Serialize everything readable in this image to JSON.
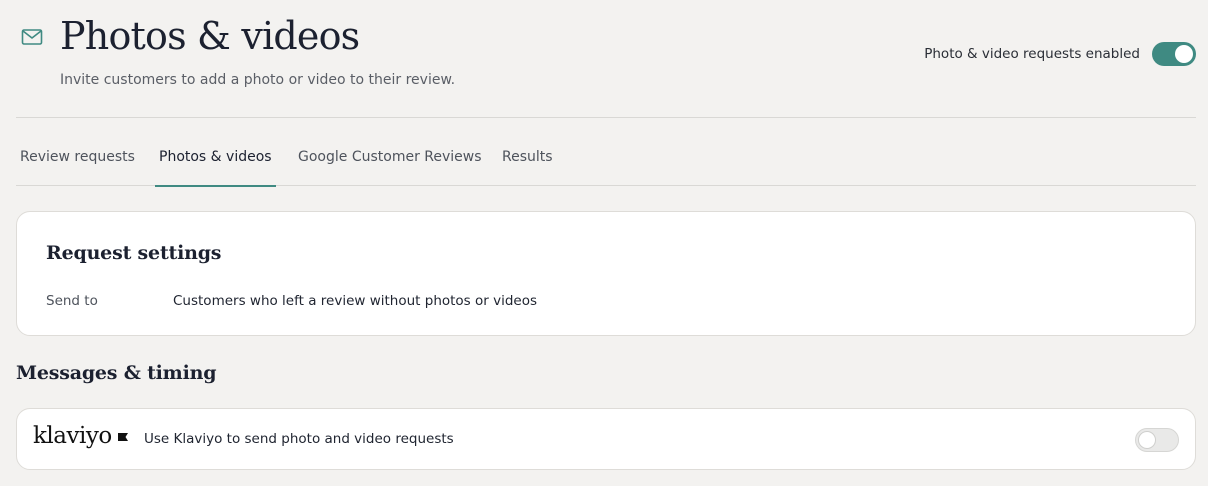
{
  "header": {
    "icon": "mail-icon",
    "title": "Photos & videos",
    "subtitle": "Invite customers to add a photo or video to their review.",
    "toggle_label": "Photo & video requests enabled",
    "toggle_on": true
  },
  "tabs": [
    {
      "label": "Review requests",
      "active": false
    },
    {
      "label": "Photos & videos",
      "active": true
    },
    {
      "label": "Google Customer Reviews",
      "active": false
    },
    {
      "label": "Results",
      "active": false
    }
  ],
  "request_settings": {
    "title": "Request settings",
    "send_to_label": "Send to",
    "send_to_value": "Customers who left a review without photos or videos"
  },
  "messages": {
    "title": "Messages & timing",
    "klaviyo": {
      "logo": "klaviyo",
      "text": "Use Klaviyo to send photo and video requests",
      "toggle_on": false
    }
  },
  "colors": {
    "accent": "#3f8a82",
    "background": "#f3f2f0",
    "card": "#ffffff"
  }
}
